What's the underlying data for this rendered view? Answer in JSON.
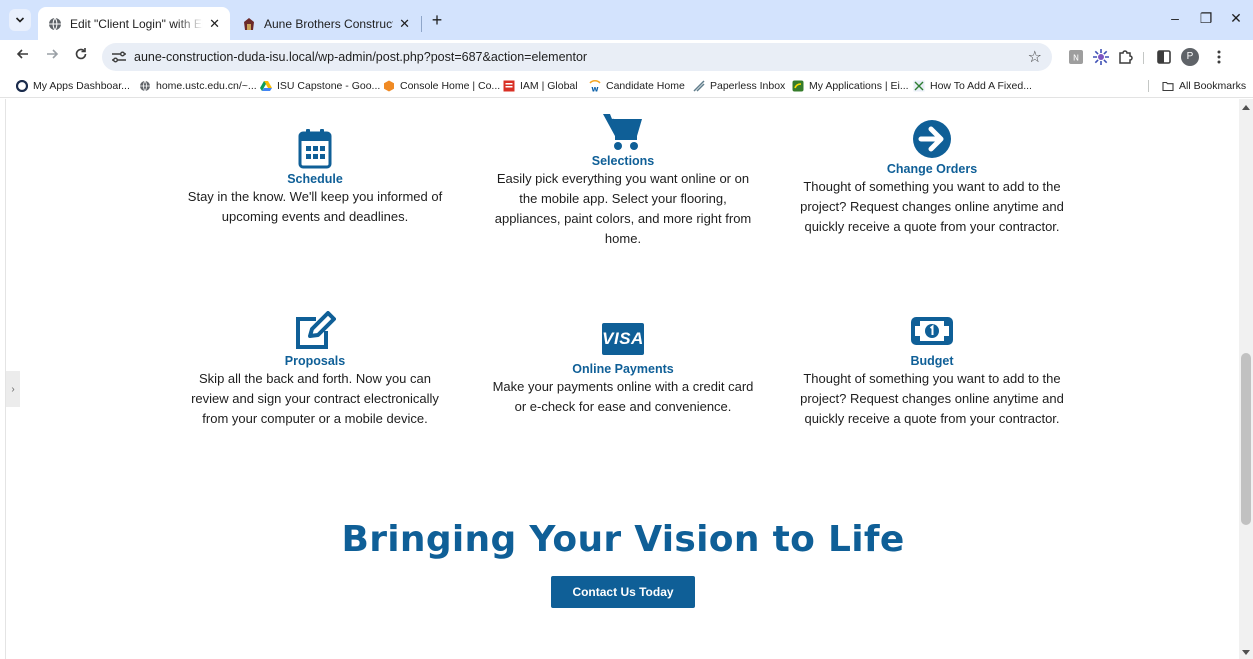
{
  "browser": {
    "tabs": [
      {
        "title": "Edit \"Client Login\" with Elementor",
        "close": "✕"
      },
      {
        "title": "Aune Brothers Construction",
        "close": "✕"
      }
    ],
    "new_tab": "+",
    "window_controls": {
      "minimize": "–",
      "restore": "❐",
      "close": "✕"
    },
    "url": "aune-construction-duda-isu.local/wp-admin/post.php?post=687&action=elementor",
    "profile_initial": "P",
    "bookmarks": [
      "My Apps Dashboar...",
      "home.ustc.edu.cn/~...",
      "ISU Capstone - Goo...",
      "Console Home | Co...",
      "IAM | Global",
      "Candidate Home",
      "Paperless Inbox",
      "My Applications | Ei...",
      "How To Add A Fixed..."
    ],
    "all_bookmarks": "All Bookmarks"
  },
  "features": [
    {
      "icon": "calendar-icon",
      "title": "Schedule",
      "desc": "Stay in the know. We'll keep you informed of upcoming events and deadlines."
    },
    {
      "icon": "shopping-cart-icon",
      "title": "Selections",
      "desc": "Easily pick everything you want online or on the mobile app. Select your flooring, appliances, paint colors, and more right from home."
    },
    {
      "icon": "arrow-circle-right-icon",
      "title": "Change Orders",
      "desc": "Thought of something you want to add to the project? Request changes online anytime and quickly receive a quote from your contractor."
    },
    {
      "icon": "edit-pencil-icon",
      "title": "Proposals",
      "desc": "Skip all the back and forth. Now you can review and sign your contract electronically from your computer or a mobile device."
    },
    {
      "icon": "visa-card-icon",
      "icon_text": "VISA",
      "title": "Online Payments",
      "desc": "Make your payments online with a credit card or e-check for ease and convenience."
    },
    {
      "icon": "money-bill-icon",
      "title": "Budget",
      "desc": "Thought of something you want to add to the project? Request changes online anytime and quickly receive a quote from your contractor."
    }
  ],
  "headline": "Bringing Your Vision to Life",
  "cta_label": "Contact Us Today",
  "colors": {
    "brand_blue": "#0f5f97",
    "tabstrip": "#d3e3fd",
    "text": "#1e1e1e"
  }
}
